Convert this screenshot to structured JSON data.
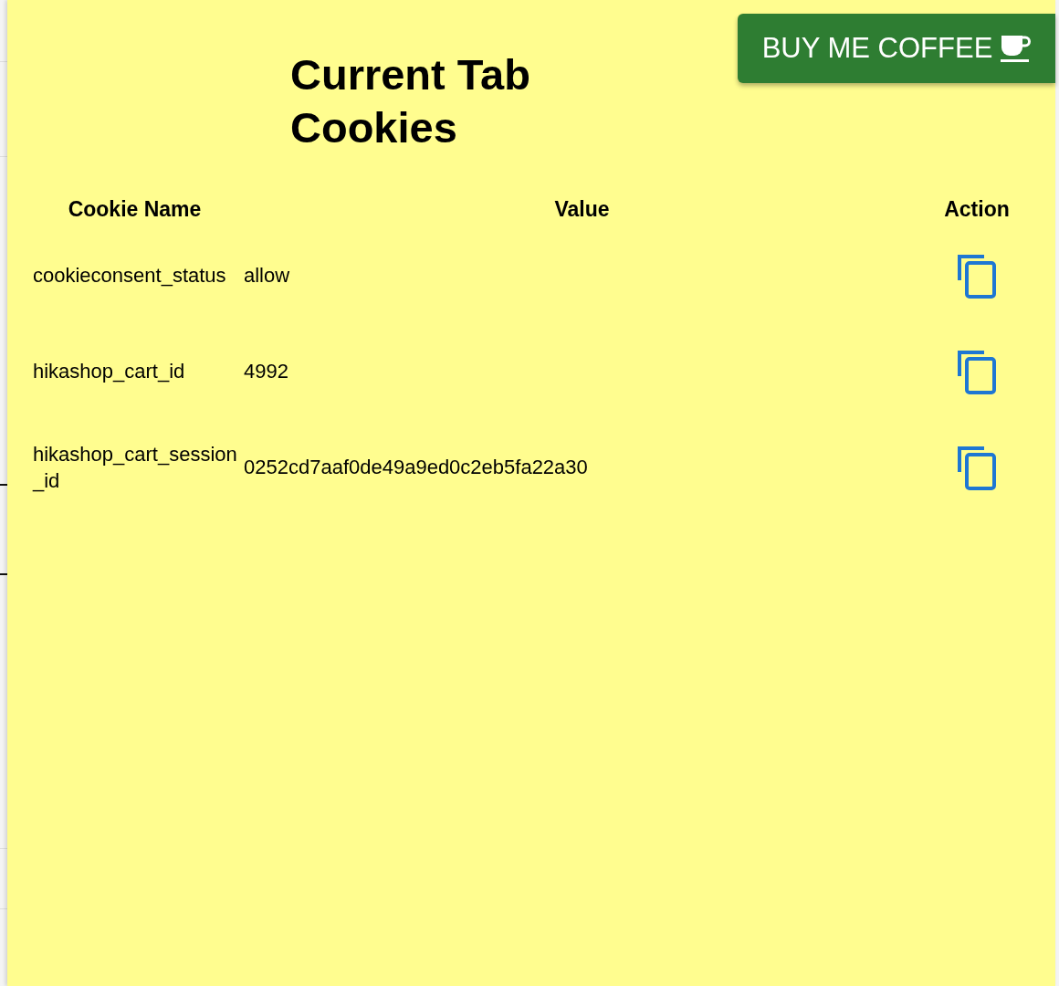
{
  "button": {
    "label": "BUY ME COFFEE"
  },
  "title": "Current Tab Cookies",
  "table": {
    "columns": [
      "Cookie Name",
      "Value",
      "Action"
    ],
    "rows": [
      {
        "name": "cookieconsent_status",
        "value": "allow"
      },
      {
        "name": "hikashop_cart_id",
        "value": "4992"
      },
      {
        "name": "hikashop_cart_session_id",
        "value": "0252cd7aaf0de49a9ed0c2eb5fa22a30"
      }
    ]
  }
}
